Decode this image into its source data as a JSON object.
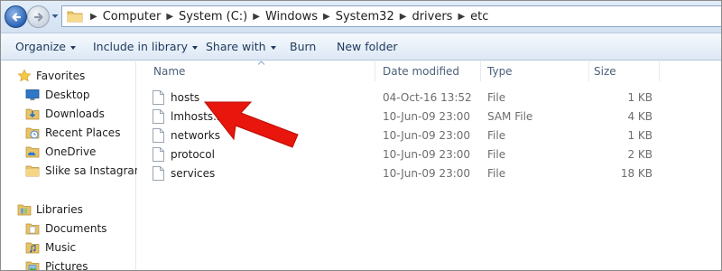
{
  "address_bar": {
    "breadcrumbs": [
      "Computer",
      "System (C:)",
      "Windows",
      "System32",
      "drivers",
      "etc"
    ]
  },
  "toolbar": {
    "organize": "Organize",
    "include_in_library": "Include in library",
    "share_with": "Share with",
    "burn": "Burn",
    "new_folder": "New folder"
  },
  "nav_pane": {
    "favorites_label": "Favorites",
    "favorites": [
      {
        "label": "Desktop",
        "icon": "desktop-icon"
      },
      {
        "label": "Downloads",
        "icon": "downloads-icon"
      },
      {
        "label": "Recent Places",
        "icon": "recent-places-icon"
      },
      {
        "label": "OneDrive",
        "icon": "onedrive-icon"
      },
      {
        "label": "Slike sa Instagrama",
        "icon": "folder-icon"
      }
    ],
    "libraries_label": "Libraries",
    "libraries": [
      {
        "label": "Documents",
        "icon": "documents-icon"
      },
      {
        "label": "Music",
        "icon": "music-icon"
      },
      {
        "label": "Pictures",
        "icon": "pictures-icon"
      }
    ]
  },
  "file_list": {
    "columns": [
      "Name",
      "Date modified",
      "Type",
      "Size"
    ],
    "rows": [
      {
        "name": "hosts",
        "date": "04-Oct-16 13:52",
        "type": "File",
        "size": "1 KB"
      },
      {
        "name": "lmhosts.sam",
        "date": "10-Jun-09 23:00",
        "type": "SAM File",
        "size": "4 KB"
      },
      {
        "name": "networks",
        "date": "10-Jun-09 23:00",
        "type": "File",
        "size": "1 KB"
      },
      {
        "name": "protocol",
        "date": "10-Jun-09 23:00",
        "type": "File",
        "size": "2 KB"
      },
      {
        "name": "services",
        "date": "10-Jun-09 23:00",
        "type": "File",
        "size": "18 KB"
      }
    ]
  },
  "colors": {
    "annotation_arrow": "#e8160c",
    "toolbar_text": "#1e395b",
    "column_header_text": "#4c607a"
  }
}
